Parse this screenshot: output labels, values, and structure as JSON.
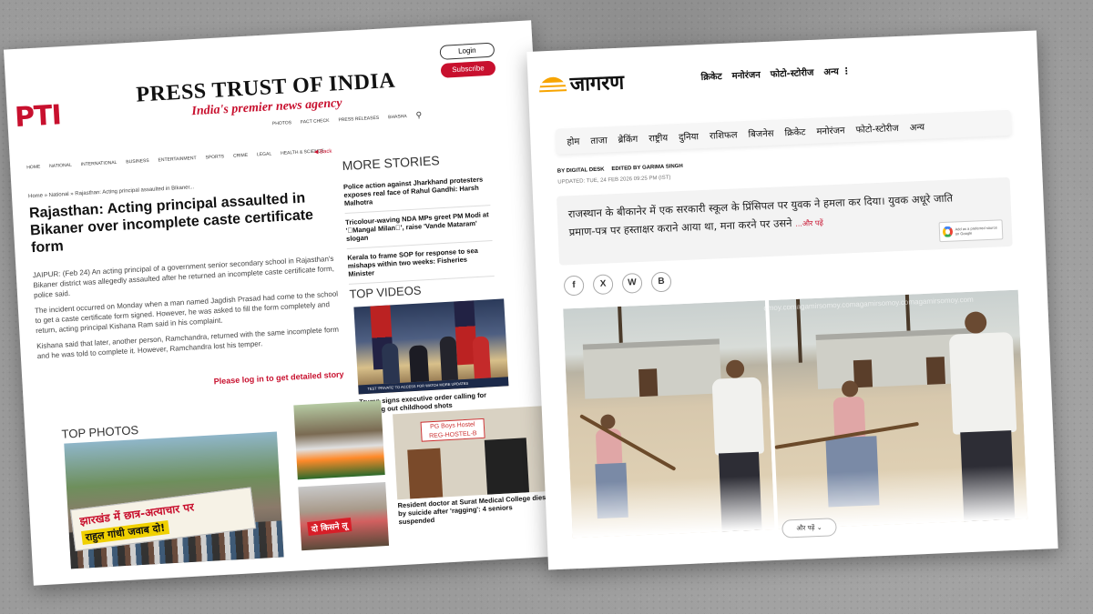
{
  "pti": {
    "logo": "PTI",
    "name": "PRESS TRUST OF INDIA",
    "tagline": "India's premier news agency",
    "login": "Login",
    "subscribe": "Subscribe",
    "topnav": [
      "PHOTOS",
      "FACT CHECK",
      "PRESS RELEASES",
      "BHASHA"
    ],
    "nav": [
      "HOME",
      "NATIONAL",
      "INTERNATIONAL",
      "BUSINESS",
      "ENTERTAINMENT",
      "SPORTS",
      "CRIME",
      "LEGAL",
      "HEALTH & SCIENCE"
    ],
    "back": "Back",
    "breadcrumb": "Home » National » Rajasthan: Acting principal assaulted in Bikaner...",
    "headline": "Rajasthan: Acting principal assaulted in Bikaner over incomplete caste certificate form",
    "body": [
      "JAIPUR: (Feb 24) An acting principal of a government senior secondary school in Rajasthan's Bikaner district was allegedly assaulted after he returned an incomplete caste certificate form, police said.",
      "The incident occurred on Monday when a man named Jagdish Prasad had come to the school to get a caste certificate form signed. However, he was asked to fill the form completely and return, acting principal Kishana Ram said in his complaint.",
      "Kishana said that later, another person, Ramchandra, returned with the same incomplete form and he was told to complete it. However, Ramchandra lost his temper."
    ],
    "cta": "Please log in to get detailed story",
    "more_stories_title": "MORE STORIES",
    "more_stories": [
      "Police action against Jharkhand protesters exposes real face of Rahul Gandhi: Harsh Malhotra",
      "Tricolour-waving NDA MPs greet PM Modi at '\u0000Mangal Milan\u0000', raise 'Vande Mataram' slogan",
      "Kerala to frame SOP for response to sea mishaps within two weeks: Fisheries Minister"
    ],
    "top_videos_title": "TOP VIDEOS",
    "video_strip": "TEST 'PRIVATE' TO ACCESS FOR WATCH MORE UPDATES",
    "video_caption": "Trump signs executive order calling for spacing out childhood shots",
    "top_photos_title": "TOP PHOTOS",
    "photo_banner_l1": "झारखंड में छात्र-अत्याचार पर",
    "photo_banner_l2": "राहुल गांधी जवाब दो!",
    "photo_s2_banner": "दो किसने लू",
    "hostel_sign": "PG Boys Hostel REG-HOSTEL-B",
    "photo_s3_caption": "Resident doctor at Surat Medical College dies by suicide after 'ragging': 4 seniors suspended"
  },
  "jagran": {
    "logo": "जागरण",
    "topnav": [
      "क्रिकेट",
      "मनोरंजन",
      "फोटो-स्टोरीज",
      "अन्य"
    ],
    "nav": [
      "होम",
      "ताजा",
      "ब्रेकिंग",
      "राष्ट्रीय",
      "दुनिया",
      "राशिफल",
      "बिजनेस",
      "क्रिकेट",
      "मनोरंजन",
      "फोटो-स्टोरीज",
      "अन्य"
    ],
    "byline_by": "BY DIGITAL DESK",
    "byline_edit": "EDITED BY GARIMA SINGH",
    "updated": "UPDATED: TUE, 24 FEB 2026 09:25 PM (IST)",
    "summary": "राजस्थान के बीकानेर में एक सरकारी स्कूल के प्रिंसिपल पर युवक ने हमला कर दिया। युवक अधूरे जाति प्रमाण-पत्र पर हस्ताक्षर कराने आया था, मना करने पर उसने",
    "read_more_inline": "...और पढ़ें",
    "google_badge": "Add as a preferred source on Google",
    "social": [
      "f",
      "X",
      "W",
      "B"
    ],
    "watermark": "omoy.comagamirsomoy.comagamirsomoy.comagamirsomoy.com",
    "read_more_button": "और पढ़ें"
  }
}
